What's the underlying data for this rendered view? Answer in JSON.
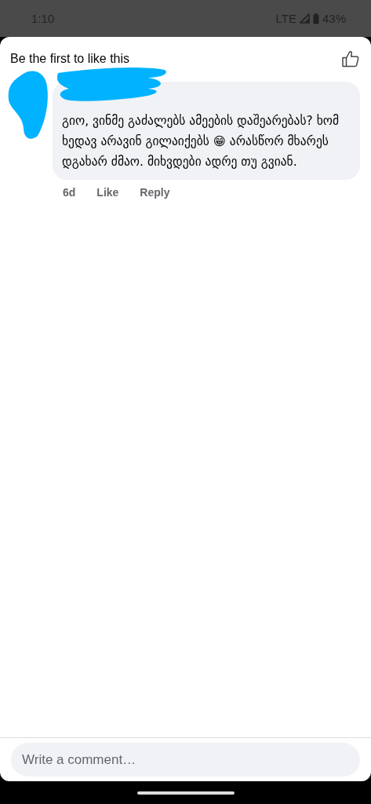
{
  "status_bar": {
    "time": "1:10",
    "network": "LTE",
    "battery": "43%"
  },
  "header": {
    "title": "Be the first to like this"
  },
  "comments": [
    {
      "text": "გიო, ვინმე გაძალებს ამეების დაშეარებას? ხომ ხედავ არავინ გილაიქებს 😁 არასწორ მხარეს დგახარ ძმაო. მიხვდები ადრე თუ გვიან.",
      "age": "6d",
      "actions": [
        "Like",
        "Reply"
      ]
    }
  ],
  "composer": {
    "placeholder": "Write a comment…"
  }
}
